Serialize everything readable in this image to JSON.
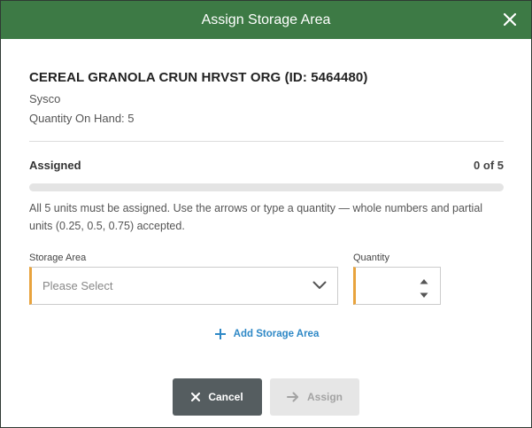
{
  "dialog": {
    "title": "Assign Storage Area",
    "close_icon": "close-icon"
  },
  "item": {
    "name": "CEREAL GRANOLA CRUN HRVST ORG (ID: 5464480)",
    "supplier": "Sysco",
    "quantity_on_hand": "Quantity On Hand: 5"
  },
  "assignment": {
    "label": "Assigned",
    "count": "0 of 5",
    "progress_fraction": 0,
    "instructions": "All 5 units must be assigned. Use the arrows or type a quantity — whole numbers and partial units (0.25, 0.5, 0.75) accepted."
  },
  "form": {
    "storage_area_label": "Storage Area",
    "storage_area_placeholder": "Please Select",
    "quantity_label": "Quantity",
    "quantity_value": ""
  },
  "add_storage_area": {
    "label": "Add Storage Area",
    "icon": "plus-icon"
  },
  "buttons": {
    "cancel": "Cancel",
    "assign": "Assign"
  },
  "colors": {
    "header_bg": "#3d7a45",
    "required_accent": "#e8a33d",
    "link": "#2e88c6",
    "cancel_bg": "#555d60",
    "assign_disabled_bg": "#e6e6e6"
  }
}
